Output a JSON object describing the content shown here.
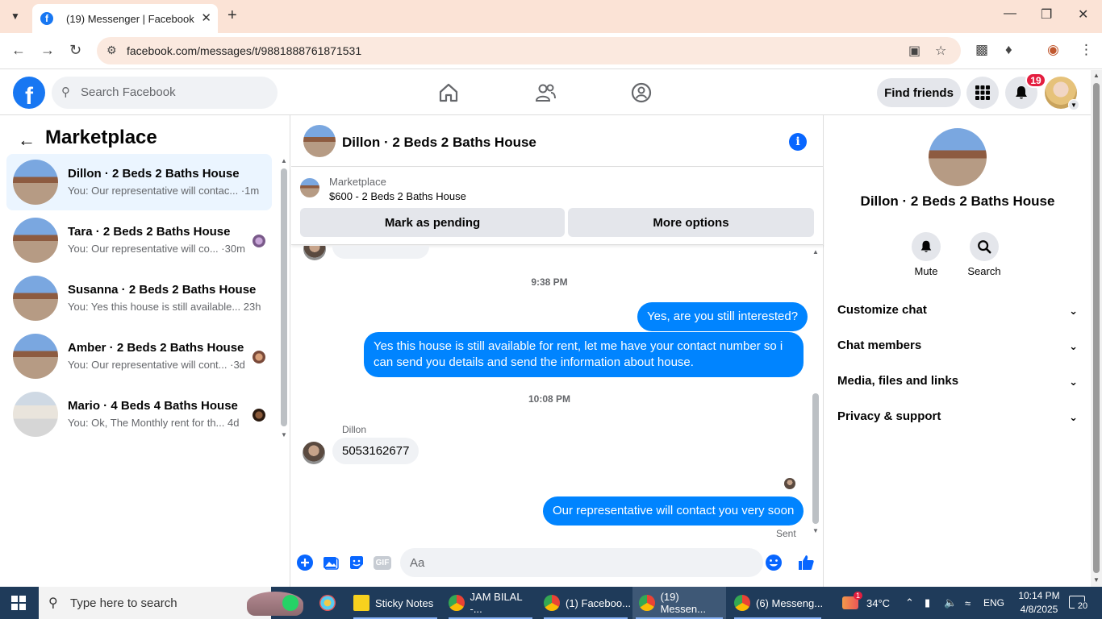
{
  "browser": {
    "tab_title": "(19) Messenger | Facebook",
    "url": "facebook.com/messages/t/9881888761871531",
    "icons": [
      "tab-menu-icon",
      "close-tab-icon",
      "new-tab-icon",
      "back-icon",
      "forward-icon",
      "reload-icon",
      "site-info-icon",
      "install-icon",
      "bookmark-star-icon",
      "extensions-icon",
      "profile-icon",
      "menu-icon"
    ]
  },
  "facebook": {
    "logo": "f",
    "search_placeholder": "Search Facebook",
    "find_friends": "Find friends",
    "notification_count": "19",
    "accent": "#1877f2"
  },
  "sidebar": {
    "title": "Marketplace",
    "conversations": [
      {
        "name": "Dillon · 2 Beds 2 Baths House",
        "preview": "You: Our representative will contac... ·1m",
        "active": true
      },
      {
        "name": "Tara · 2 Beds 2 Baths House",
        "preview": "You: Our representative will co... ·30m",
        "active": false
      },
      {
        "name": "Susanna · 2 Beds 2 Baths House",
        "preview": "You: Yes this house is still available... 23h",
        "active": false
      },
      {
        "name": "Amber · 2 Beds 2 Baths House",
        "preview": "You: Our representative will cont... ·3d",
        "active": false
      },
      {
        "name": "Mario · 4 Beds 4 Baths House",
        "preview": "You: Ok, The Monthly rent for th... 4d",
        "active": false
      }
    ]
  },
  "chat": {
    "title": "Dillon · 2 Beds 2 Baths House",
    "marketplace_label": "Marketplace",
    "listing": "$600 - 2 Beds 2 Baths House",
    "mark_pending": "Mark as pending",
    "more_options": "More options",
    "messages": [
      {
        "type": "timestamp",
        "text": "9:38 PM"
      },
      {
        "type": "out",
        "text": "Yes, are you still interested?"
      },
      {
        "type": "out",
        "text": "Yes this house is still available for rent, let me have your contact number so i can send you details and send the information about house."
      },
      {
        "type": "timestamp",
        "text": "10:08 PM"
      },
      {
        "type": "sender",
        "text": "Dillon"
      },
      {
        "type": "in",
        "text": "5053162677"
      },
      {
        "type": "out",
        "text": "Our representative will contact you very soon"
      },
      {
        "type": "status",
        "text": "Sent"
      }
    ],
    "composer_placeholder": "Aa",
    "gif_label": "GIF"
  },
  "details": {
    "name": "Dillon · 2 Beds 2 Baths House",
    "mute": "Mute",
    "search": "Search",
    "sections": [
      "Customize chat",
      "Chat members",
      "Media, files and links",
      "Privacy & support"
    ]
  },
  "taskbar": {
    "search_placeholder": "Type here to search",
    "apps": [
      {
        "label": "Sticky Notes"
      },
      {
        "label": "JAM BILAL -..."
      },
      {
        "label": "(1) Faceboo..."
      },
      {
        "label": "(19) Messen..."
      },
      {
        "label": "(6) Messeng..."
      }
    ],
    "weather": "34°C",
    "weather_badge": "1",
    "language": "ENG",
    "time": "10:14 PM",
    "date": "4/8/2025",
    "notifications": "20"
  }
}
